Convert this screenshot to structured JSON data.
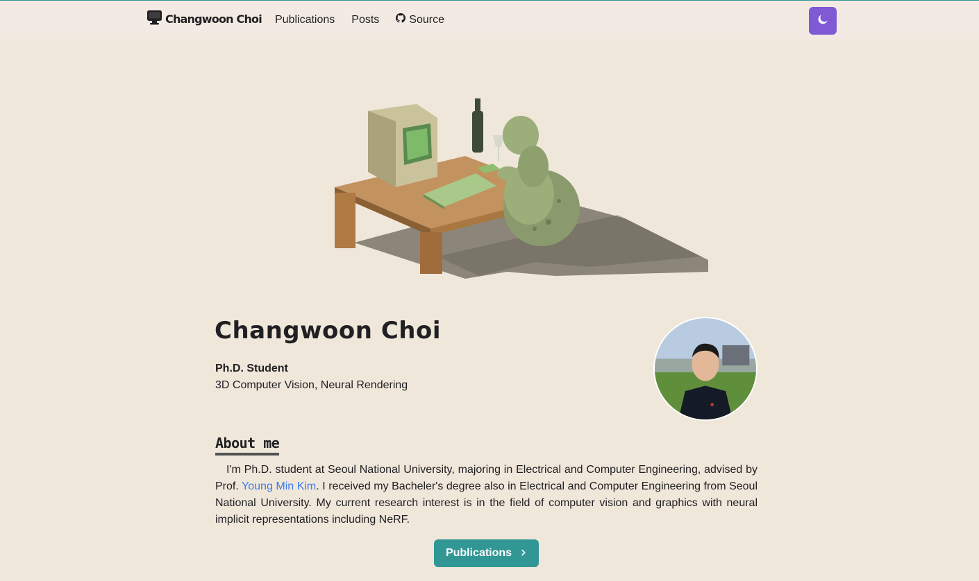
{
  "nav": {
    "logo_text": "Changwoon Choi",
    "links": [
      "Publications",
      "Posts",
      "Source"
    ]
  },
  "profile": {
    "name": "Changwoon Choi",
    "role": "Ph.D. Student",
    "fields": "3D Computer Vision, Neural Rendering"
  },
  "about": {
    "title": "About me",
    "text_before": "I'm Ph.D. student at Seoul National University, majoring in Electrical and Computer Engineering, advised by Prof. ",
    "advisor_link": "Young Min Kim",
    "text_after": ". I received my Bacheler's degree also in Electrical and Computer Engineering from Seoul National University. My current research interest is in the field of computer vision and graphics with neural implicit representations including NeRF."
  },
  "button": {
    "label": "Publications"
  },
  "colors": {
    "background": "#f0e7db",
    "navbar": "#f3ebe3",
    "accent_teal": "#319795",
    "theme_button": "#805ad5",
    "link": "#3d7aed"
  },
  "icons": [
    "computer-icon",
    "github-icon",
    "moon-icon",
    "chevron-right-icon"
  ]
}
